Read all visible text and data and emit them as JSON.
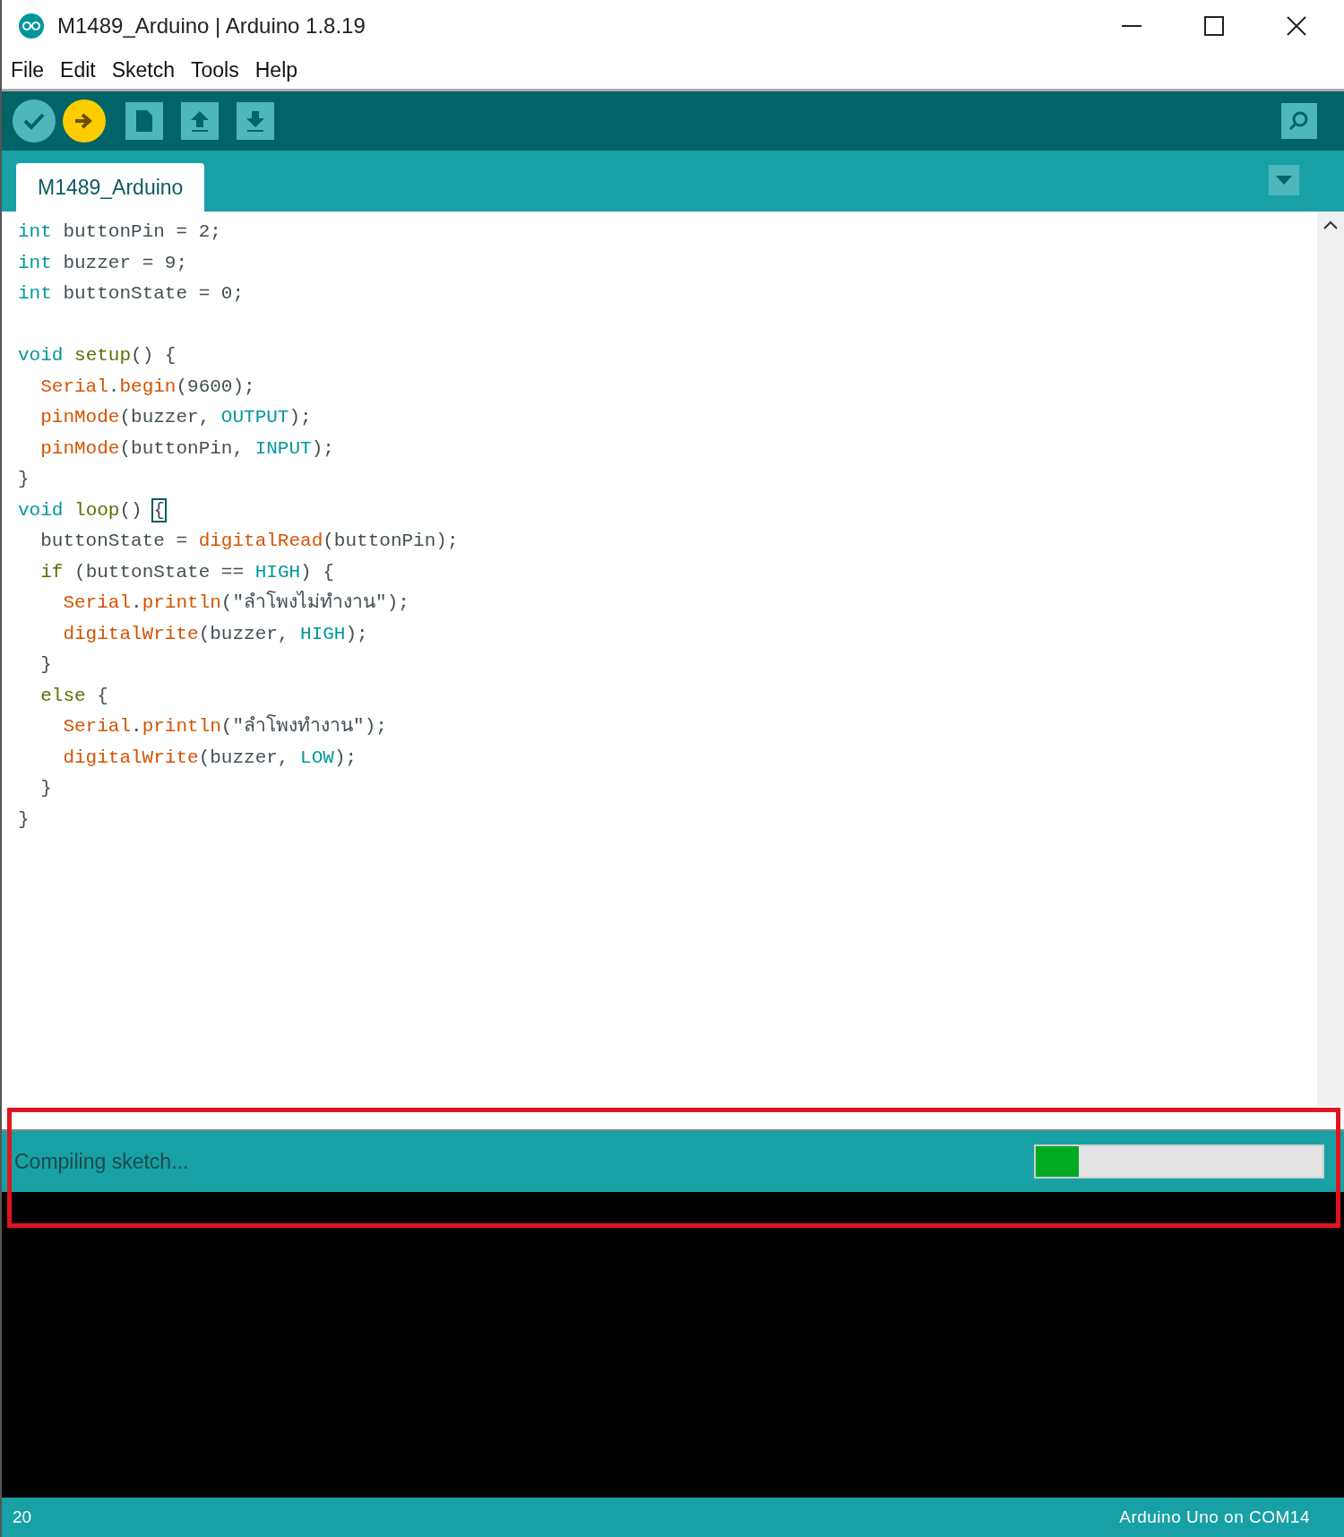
{
  "window": {
    "title": "M1489_Arduino | Arduino 1.8.19"
  },
  "menu": [
    "File",
    "Edit",
    "Sketch",
    "Tools",
    "Help"
  ],
  "tabs": [
    {
      "label": "M1489_Arduino",
      "selected": true
    }
  ],
  "code_lines": [
    {
      "kind": "code",
      "tokens": [
        {
          "kind": "type",
          "text": "int"
        },
        {
          "kind": "plain",
          "text": " buttonPin = 2;"
        }
      ]
    },
    {
      "kind": "code",
      "tokens": [
        {
          "kind": "type",
          "text": "int"
        },
        {
          "kind": "plain",
          "text": " buzzer = 9;"
        }
      ]
    },
    {
      "kind": "code",
      "tokens": [
        {
          "kind": "type",
          "text": "int"
        },
        {
          "kind": "plain",
          "text": " buttonState = 0;"
        }
      ]
    },
    {
      "kind": "blank"
    },
    {
      "kind": "code",
      "tokens": [
        {
          "kind": "type",
          "text": "void"
        },
        {
          "kind": "keyword",
          "text": " setup"
        },
        {
          "kind": "plain",
          "text": "() {"
        }
      ]
    },
    {
      "kind": "code",
      "tokens": [
        {
          "kind": "func",
          "text": "  Serial"
        },
        {
          "kind": "plain",
          "text": "."
        },
        {
          "kind": "func",
          "text": "begin"
        },
        {
          "kind": "plain",
          "text": "(9600);"
        }
      ]
    },
    {
      "kind": "code",
      "tokens": [
        {
          "kind": "func",
          "text": "  pinMode"
        },
        {
          "kind": "plain",
          "text": "(buzzer, "
        },
        {
          "kind": "const",
          "text": "OUTPUT"
        },
        {
          "kind": "plain",
          "text": ");"
        }
      ]
    },
    {
      "kind": "code",
      "tokens": [
        {
          "kind": "func",
          "text": "  pinMode"
        },
        {
          "kind": "plain",
          "text": "(buttonPin, "
        },
        {
          "kind": "const",
          "text": "INPUT"
        },
        {
          "kind": "plain",
          "text": ");"
        }
      ]
    },
    {
      "kind": "code",
      "tokens": [
        {
          "kind": "plain",
          "text": "}"
        }
      ]
    },
    {
      "kind": "code",
      "tokens": [
        {
          "kind": "type",
          "text": "void"
        },
        {
          "kind": "keyword",
          "text": " loop"
        },
        {
          "kind": "plain",
          "text": "() "
        },
        {
          "kind": "bracket-match",
          "text": "{"
        }
      ]
    },
    {
      "kind": "code",
      "tokens": [
        {
          "kind": "plain",
          "text": "  buttonState = "
        },
        {
          "kind": "func",
          "text": "digitalRead"
        },
        {
          "kind": "plain",
          "text": "(buttonPin);"
        }
      ]
    },
    {
      "kind": "code",
      "tokens": [
        {
          "kind": "keyword",
          "text": "  if"
        },
        {
          "kind": "plain",
          "text": " (buttonState == "
        },
        {
          "kind": "const",
          "text": "HIGH"
        },
        {
          "kind": "plain",
          "text": ") {"
        }
      ]
    },
    {
      "kind": "code",
      "tokens": [
        {
          "kind": "func",
          "text": "    Serial"
        },
        {
          "kind": "plain",
          "text": "."
        },
        {
          "kind": "func",
          "text": "println"
        },
        {
          "kind": "plain",
          "text": "(\"ลำโพงไม่ทำงาน\");"
        }
      ]
    },
    {
      "kind": "code",
      "tokens": [
        {
          "kind": "func",
          "text": "    digitalWrite"
        },
        {
          "kind": "plain",
          "text": "(buzzer, "
        },
        {
          "kind": "const",
          "text": "HIGH"
        },
        {
          "kind": "plain",
          "text": ");"
        }
      ]
    },
    {
      "kind": "code",
      "tokens": [
        {
          "kind": "plain",
          "text": "  }"
        }
      ]
    },
    {
      "kind": "code",
      "tokens": [
        {
          "kind": "keyword",
          "text": "  else"
        },
        {
          "kind": "plain",
          "text": " {"
        }
      ]
    },
    {
      "kind": "code",
      "tokens": [
        {
          "kind": "func",
          "text": "    Serial"
        },
        {
          "kind": "plain",
          "text": "."
        },
        {
          "kind": "func",
          "text": "println"
        },
        {
          "kind": "plain",
          "text": "(\"ลำโพงทำงาน\");"
        }
      ]
    },
    {
      "kind": "code",
      "tokens": [
        {
          "kind": "func",
          "text": "    digitalWrite"
        },
        {
          "kind": "plain",
          "text": "(buzzer, "
        },
        {
          "kind": "const",
          "text": "LOW"
        },
        {
          "kind": "plain",
          "text": ");"
        }
      ]
    },
    {
      "kind": "code",
      "tokens": [
        {
          "kind": "plain",
          "text": "  }"
        }
      ]
    },
    {
      "kind": "code",
      "tokens": [
        {
          "kind": "plain",
          "text": "}"
        }
      ]
    }
  ],
  "status": {
    "message": "Compiling sketch...",
    "level": 0.15
  },
  "footer": {
    "line": "20",
    "board": "Arduino Uno on COM14"
  }
}
